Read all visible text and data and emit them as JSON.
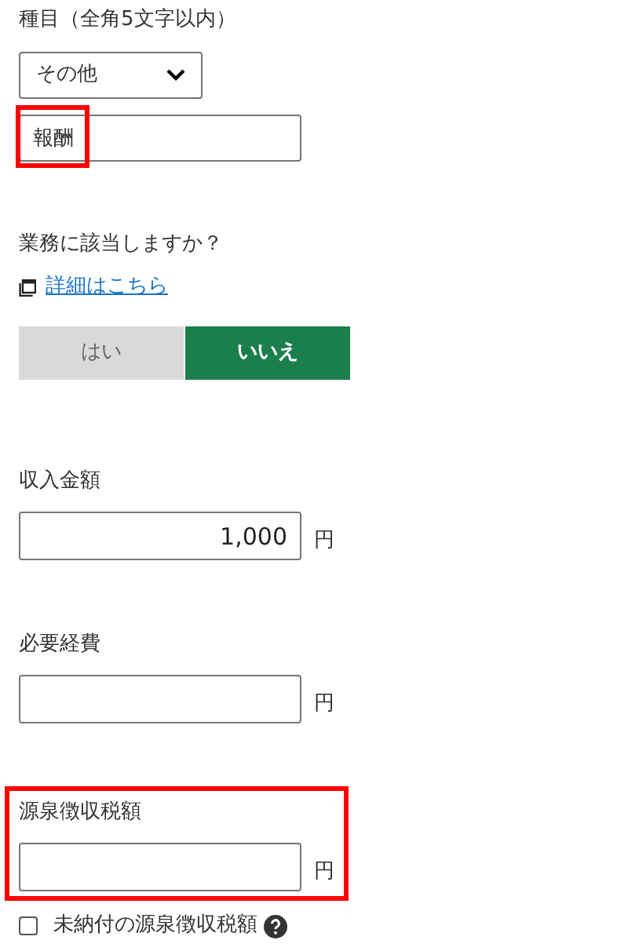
{
  "category": {
    "label": "種目（全角5文字以内）",
    "select_value": "その他",
    "input_value": "報酬",
    "input_highlighted": true
  },
  "business": {
    "question": "業務に該当しますか？",
    "link": "詳細はこちら",
    "options": [
      {
        "label": "はい",
        "selected": false
      },
      {
        "label": "いいえ",
        "selected": true
      }
    ]
  },
  "amounts": [
    {
      "label": "収入金額",
      "value": "1,000",
      "unit": "円",
      "highlighted": false
    },
    {
      "label": "必要経費",
      "unit": "円",
      "highlighted": false
    },
    {
      "label": "源泉徴収税額",
      "unit": "円",
      "highlighted": true
    }
  ],
  "unpaid": {
    "label": "未納付の源泉徴収税額",
    "checked": false
  }
}
